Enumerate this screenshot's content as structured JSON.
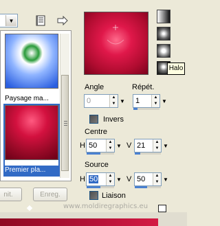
{
  "left_panel": {
    "thumbnails": [
      {
        "label": "Paysage ma..."
      },
      {
        "label": "Premier pla..."
      }
    ],
    "buttons": {
      "import_label": "nit.",
      "save_label": "Enreg."
    }
  },
  "right_panel": {
    "angle": {
      "label": "Angle",
      "value": "0"
    },
    "repeat": {
      "label": "Répét.",
      "value": "1"
    },
    "invert": {
      "label": "Inverser",
      "visible_label": "Invers"
    },
    "center": {
      "label": "Centre",
      "h_label": "H",
      "h_value": "50",
      "v_label": "V",
      "v_value": "21"
    },
    "source": {
      "label": "Source",
      "h_label": "H",
      "h_value": "50",
      "v_label": "V",
      "v_value": "50"
    },
    "link": {
      "label": "Liaison",
      "visible_label": "Liaison"
    },
    "gradient_styles": [
      "linear",
      "rectangular",
      "sunburst",
      "radial"
    ],
    "tooltip": "Halo"
  },
  "watermark": "www.moldiregraphics.eu",
  "colors": {
    "gradient_dark": "#6e0018",
    "gradient_mid": "#c8103c",
    "gradient_light": "#ff3f6a",
    "selection": "#316ac5"
  }
}
